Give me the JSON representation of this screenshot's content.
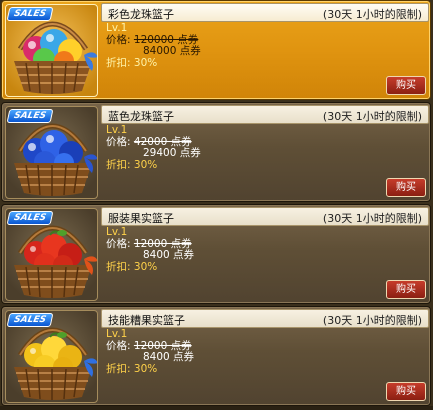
{
  "colors": {
    "selected_card": "#e09410",
    "card": "#5f4f36",
    "buy_button": "#a52a1b",
    "sales_badge": "#1a6ee6",
    "level_text": "#ffd24a"
  },
  "items": [
    {
      "sales_badge": "SALES",
      "name": "彩色龙珠篮子",
      "limit": "(30天 1小时的限制)",
      "level": "Lv.1",
      "price_label": "价格:",
      "original_price": "120000 点券",
      "sale_price": "84000 点券",
      "discount_label": "折扣:",
      "discount_value": "30%",
      "buy_label": "购买",
      "selected": true,
      "icon": "multicolor-orb-basket-icon"
    },
    {
      "sales_badge": "SALES",
      "name": "蓝色龙珠篮子",
      "limit": "(30天 1小时的限制)",
      "level": "Lv.1",
      "price_label": "价格:",
      "original_price": "42000 点券",
      "sale_price": "29400 点券",
      "discount_label": "折扣:",
      "discount_value": "30%",
      "buy_label": "购买",
      "selected": false,
      "icon": "blue-orb-basket-icon"
    },
    {
      "sales_badge": "SALES",
      "name": "服装果实篮子",
      "limit": "(30天 1小时的限制)",
      "level": "Lv.1",
      "price_label": "价格:",
      "original_price": "12000 点券",
      "sale_price": "8400 点券",
      "discount_label": "折扣:",
      "discount_value": "30%",
      "buy_label": "购买",
      "selected": false,
      "icon": "red-fruit-basket-icon"
    },
    {
      "sales_badge": "SALES",
      "name": "技能糟果实篮子",
      "limit": "(30天 1小时的限制)",
      "level": "Lv.1",
      "price_label": "价格:",
      "original_price": "12000 点券",
      "sale_price": "8400 点券",
      "discount_label": "折扣:",
      "discount_value": "30%",
      "buy_label": "购买",
      "selected": false,
      "icon": "yellow-fruit-basket-icon"
    }
  ]
}
